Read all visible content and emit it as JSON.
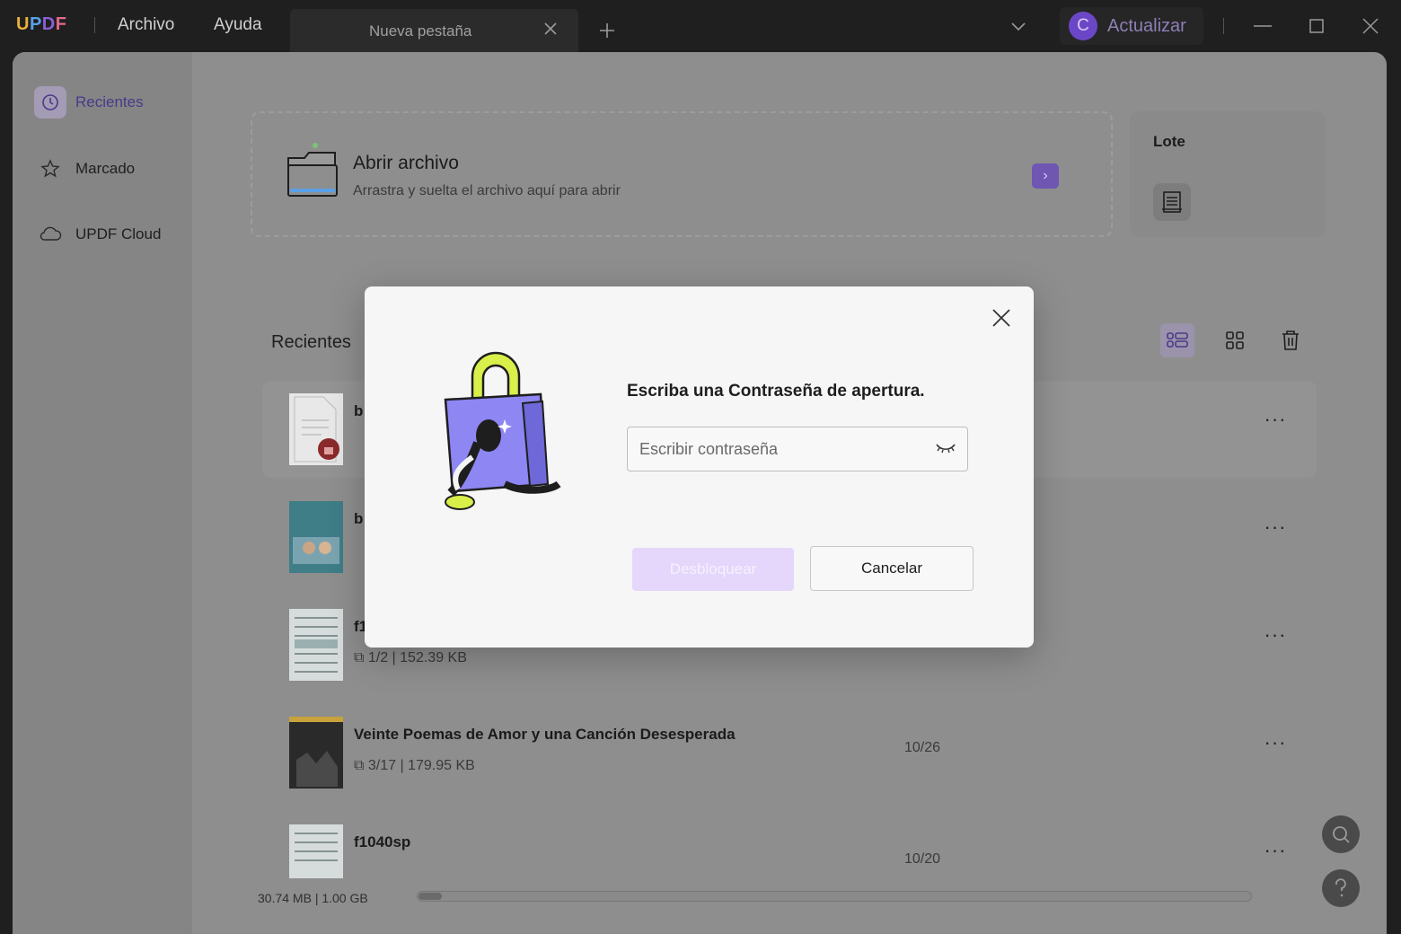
{
  "titlebar": {
    "logo": [
      "U",
      "P",
      "D",
      "F"
    ],
    "menu": [
      "Archivo",
      "Ayuda"
    ],
    "tab_label": "Nueva pestaña",
    "upgrade_avatar": "C",
    "upgrade_label": "Actualizar"
  },
  "sidebar": {
    "items": [
      {
        "label": "Recientes",
        "icon": "clock-icon",
        "active": true
      },
      {
        "label": "Marcado",
        "icon": "star-icon",
        "active": false
      },
      {
        "label": "UPDF Cloud",
        "icon": "cloud-icon",
        "active": false
      }
    ]
  },
  "open_file": {
    "title": "Abrir archivo",
    "subtitle": "Arrastra y suelta el archivo aquí para abrir",
    "arrow": "›"
  },
  "batch": {
    "title": "Lote"
  },
  "recents": {
    "title": "Recientes",
    "files": [
      {
        "name": "b",
        "meta": "",
        "date": "",
        "locked": true
      },
      {
        "name": "b",
        "meta": "",
        "date": ""
      },
      {
        "name": "f1",
        "meta": "⧉ 1/2  |  152.39 KB",
        "date": ""
      },
      {
        "name": "Veinte Poemas de Amor y una Canción Desesperada",
        "meta": "⧉ 3/17  |  179.95 KB",
        "date": "10/26"
      },
      {
        "name": "f1040sp",
        "meta": "",
        "date": "10/20"
      }
    ],
    "more": "···"
  },
  "footer": {
    "storage": "30.74 MB | 1.00 GB"
  },
  "modal": {
    "title": "Escriba una Contraseña de apertura.",
    "placeholder": "Escribir contraseña",
    "unlock": "Desbloquear",
    "cancel": "Cancelar"
  },
  "colors": {
    "accent": "#7b5fd0",
    "unlock_disabled": "#e4d7fb"
  }
}
